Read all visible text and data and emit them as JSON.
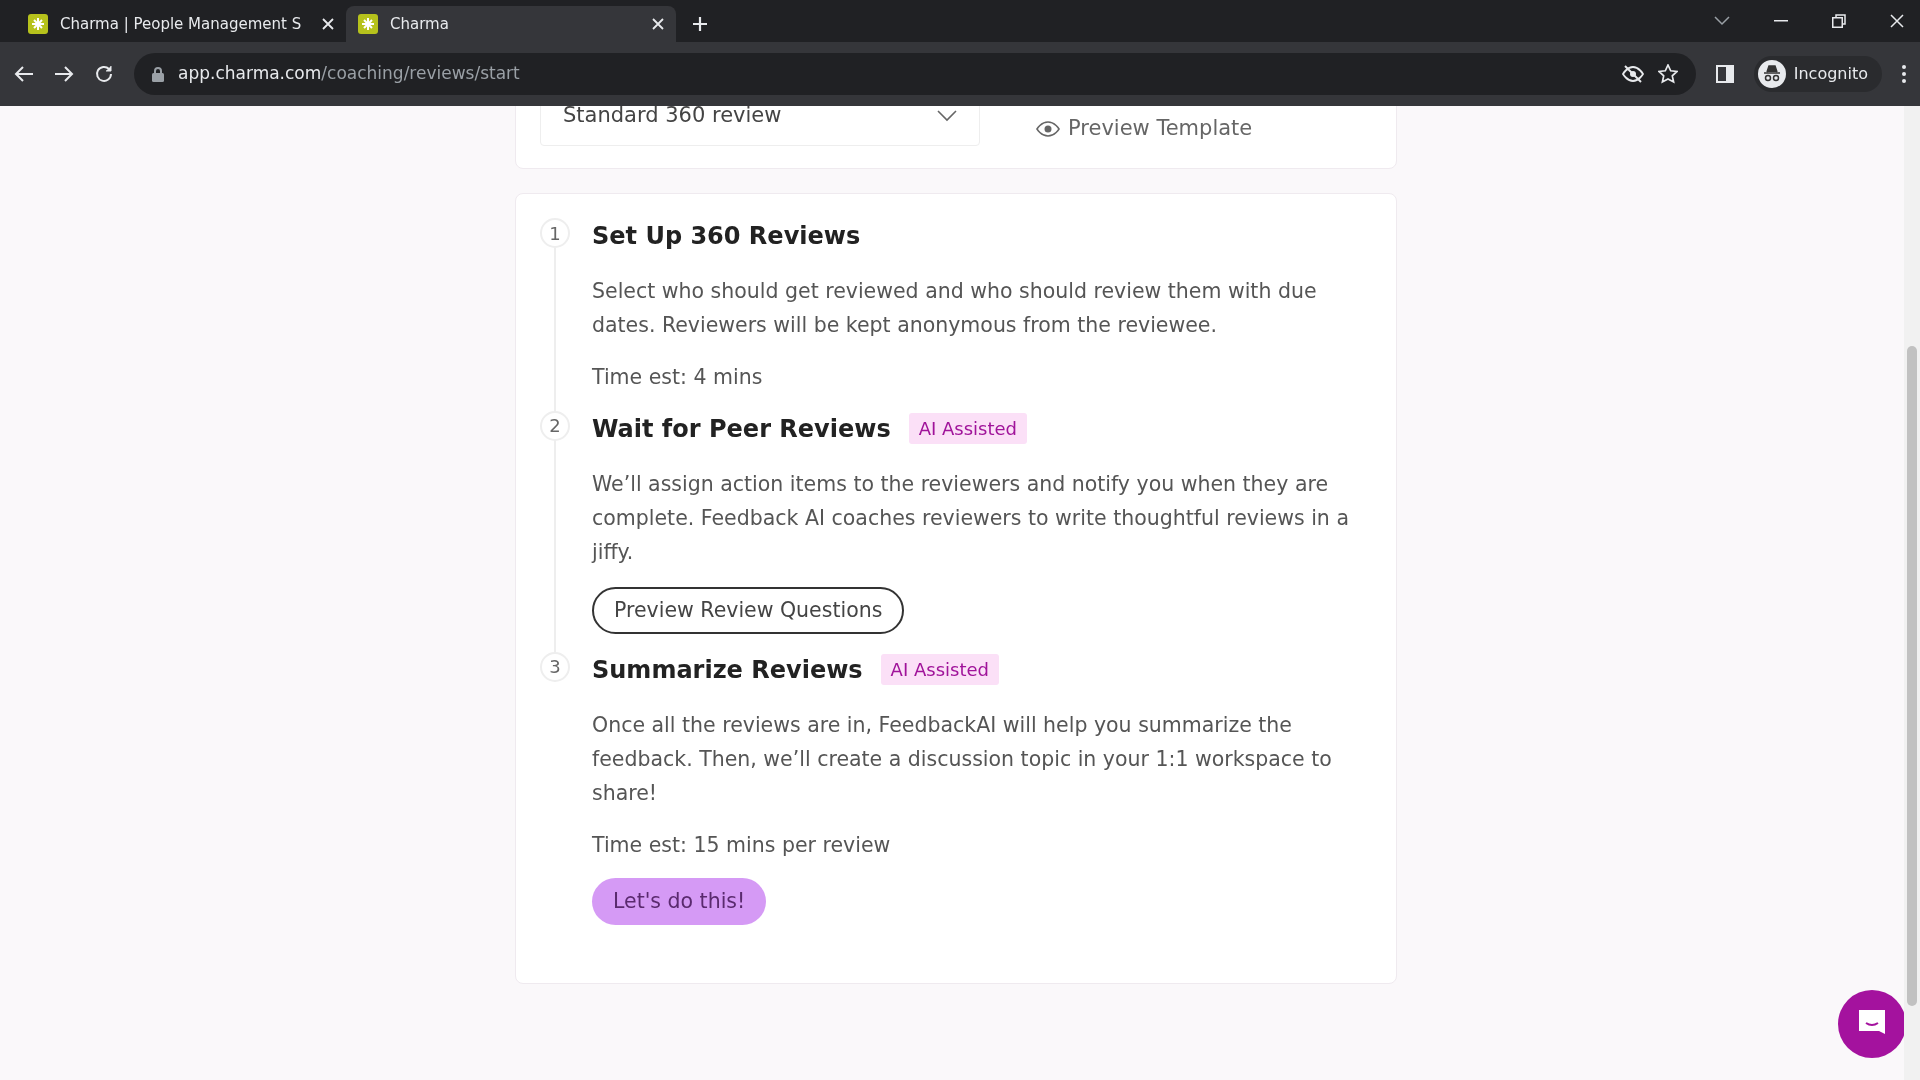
{
  "browser": {
    "tabs": [
      {
        "title": "Charma | People Management S",
        "selected": false
      },
      {
        "title": "Charma",
        "selected": true
      }
    ],
    "url": {
      "host": "app.charma.com",
      "path": "/coaching/reviews/start"
    },
    "profile": "Incognito"
  },
  "template_card": {
    "select_value": "Standard 360 review",
    "link": "Preview Template"
  },
  "steps": [
    {
      "number": "1",
      "title": "Set Up 360 Reviews",
      "description": "Select who should get reviewed and who should review them with due dates. Reviewers will be kept anonymous from the reviewee.",
      "time_est": "Time est: 4 mins"
    },
    {
      "number": "2",
      "title": "Wait for Peer Reviews",
      "badge": "AI Assisted",
      "description": "We’ll assign action items to the reviewers and notify you when they are complete. Feedback AI coaches reviewers to write thoughtful reviews in a jiffy.",
      "button": {
        "label": "Preview Review Questions",
        "kind": "outline"
      }
    },
    {
      "number": "3",
      "title": "Summarize Reviews",
      "badge": "AI Assisted",
      "description": "Once all the reviews are in, FeedbackAI will help you summarize the feedback. Then, we’ll create a discussion topic in your 1:1 workspace to share!",
      "time_est": "Time est: 15 mins per review",
      "button": {
        "label": "Let's do this!",
        "kind": "primary"
      }
    }
  ]
}
